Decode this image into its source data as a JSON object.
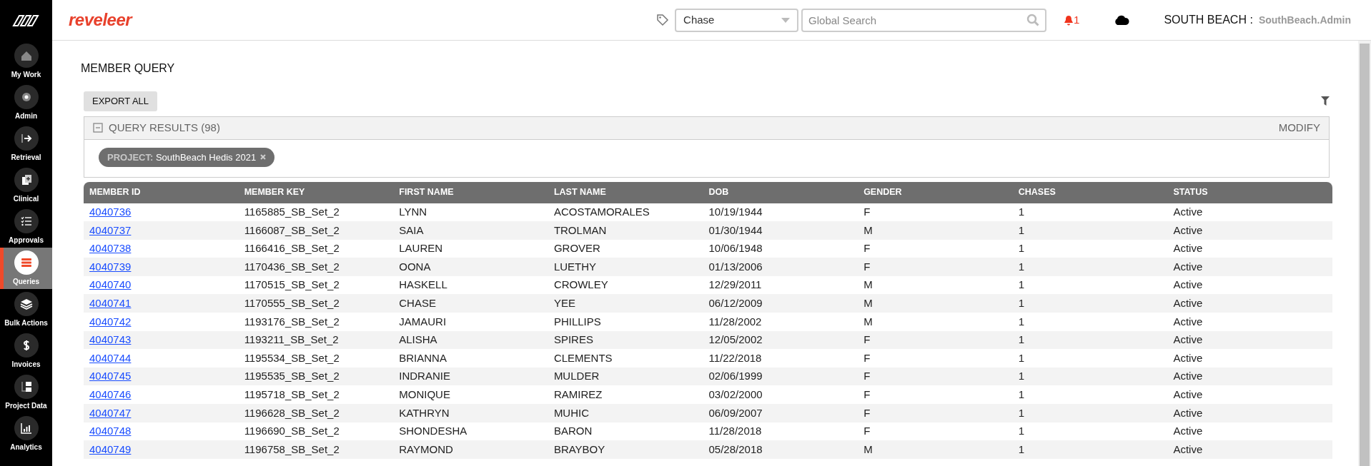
{
  "sidebar": {
    "items": [
      {
        "label": "My Work",
        "selected": false
      },
      {
        "label": "Admin",
        "selected": false
      },
      {
        "label": "Retrieval",
        "selected": false
      },
      {
        "label": "Clinical",
        "selected": false
      },
      {
        "label": "Approvals",
        "selected": false
      },
      {
        "label": "Queries",
        "selected": true
      },
      {
        "label": "Bulk Actions",
        "selected": false
      },
      {
        "label": "Invoices",
        "selected": false
      },
      {
        "label": "Project Data",
        "selected": false
      },
      {
        "label": "Analytics",
        "selected": false
      }
    ]
  },
  "header": {
    "logo": "reveleer",
    "search_type": {
      "value": "Chase"
    },
    "search": {
      "placeholder": "Global Search"
    },
    "notifications": "1",
    "org": "SOUTH BEACH :",
    "user": "SouthBeach.Admin"
  },
  "page": {
    "title": "MEMBER QUERY",
    "export_button": "EXPORT ALL"
  },
  "query_panel": {
    "title": "QUERY RESULTS (98)",
    "expanded": true,
    "modify": "MODIFY",
    "filters": [
      {
        "label": "PROJECT:",
        "value": "SouthBeach Hedis 2021"
      }
    ]
  },
  "table": {
    "columns": [
      "MEMBER ID",
      "MEMBER KEY",
      "FIRST NAME",
      "LAST NAME",
      "DOB",
      "GENDER",
      "CHASES",
      "STATUS"
    ],
    "rows": [
      [
        "4040736",
        "1165885_SB_Set_2",
        "LYNN",
        "ACOSTAMORALES",
        "10/19/1944",
        "F",
        "1",
        "Active"
      ],
      [
        "4040737",
        "1166087_SB_Set_2",
        "SAIA",
        "TROLMAN",
        "01/30/1944",
        "M",
        "1",
        "Active"
      ],
      [
        "4040738",
        "1166416_SB_Set_2",
        "LAUREN",
        "GROVER",
        "10/06/1948",
        "F",
        "1",
        "Active"
      ],
      [
        "4040739",
        "1170436_SB_Set_2",
        "OONA",
        "LUETHY",
        "01/13/2006",
        "F",
        "1",
        "Active"
      ],
      [
        "4040740",
        "1170515_SB_Set_2",
        "HASKELL",
        "CROWLEY",
        "12/29/2011",
        "M",
        "1",
        "Active"
      ],
      [
        "4040741",
        "1170555_SB_Set_2",
        "CHASE",
        "YEE",
        "06/12/2009",
        "M",
        "1",
        "Active"
      ],
      [
        "4040742",
        "1193176_SB_Set_2",
        "JAMAURI",
        "PHILLIPS",
        "11/28/2002",
        "M",
        "1",
        "Active"
      ],
      [
        "4040743",
        "1193211_SB_Set_2",
        "ALISHA",
        "SPIRES",
        "12/05/2002",
        "F",
        "1",
        "Active"
      ],
      [
        "4040744",
        "1195534_SB_Set_2",
        "BRIANNA",
        "CLEMENTS",
        "11/22/2018",
        "F",
        "1",
        "Active"
      ],
      [
        "4040745",
        "1195535_SB_Set_2",
        "INDRANIE",
        "MULDER",
        "02/06/1999",
        "F",
        "1",
        "Active"
      ],
      [
        "4040746",
        "1195718_SB_Set_2",
        "MONIQUE",
        "RAMIREZ",
        "03/02/2000",
        "F",
        "1",
        "Active"
      ],
      [
        "4040747",
        "1196628_SB_Set_2",
        "KATHRYN",
        "MUHIC",
        "06/09/2007",
        "F",
        "1",
        "Active"
      ],
      [
        "4040748",
        "1196690_SB_Set_2",
        "SHONDESHA",
        "BARON",
        "11/28/2018",
        "F",
        "1",
        "Active"
      ],
      [
        "4040749",
        "1196758_SB_Set_2",
        "RAYMOND",
        "BRAYBOY",
        "05/28/2018",
        "M",
        "1",
        "Active"
      ]
    ]
  }
}
